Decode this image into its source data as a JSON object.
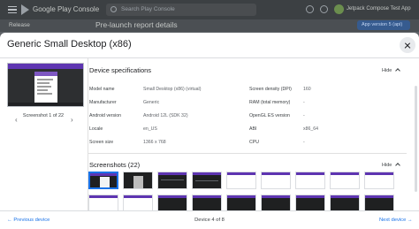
{
  "app": {
    "brand": "Google Play Console",
    "search_placeholder": "Search Play Console",
    "account_name": "Jetpack Compose Test App"
  },
  "subheader": {
    "release_label": "Release",
    "page_title": "Pre-launch report details",
    "version_button": "App version 5 (api)"
  },
  "dialog": {
    "title": "Generic Small Desktop (x86)",
    "screenshot_caption": "Screenshot 1 of 22",
    "specs": {
      "section_title": "Device specifications",
      "hide_label": "Hide",
      "left": [
        {
          "label": "Model name",
          "value": "Small Desktop (x86) (virtual)"
        },
        {
          "label": "Manufacturer",
          "value": "Generic"
        },
        {
          "label": "Android version",
          "value": "Android 12L (SDK 32)"
        },
        {
          "label": "Locale",
          "value": "en_US"
        },
        {
          "label": "Screen size",
          "value": "1366 x 768"
        }
      ],
      "right": [
        {
          "label": "Screen density (DPI)",
          "value": "160"
        },
        {
          "label": "RAM (total memory)",
          "value": "-"
        },
        {
          "label": "OpenGL ES version",
          "value": "-"
        },
        {
          "label": "ABI",
          "value": "x86_64"
        },
        {
          "label": "CPU",
          "value": "-"
        }
      ]
    },
    "screenshots": {
      "section_title": "Screenshots (22)",
      "hide_label": "Hide"
    },
    "footer": {
      "previous": "Previous device",
      "count": "Device 4 of 8",
      "next": "Next device"
    }
  },
  "colors": {
    "accent": "#1a73e8",
    "purple_app_bar": "#5e35b1",
    "overlay_bar": "#3c4043"
  },
  "icons": [
    "menu-icon",
    "play-logo-icon",
    "search-icon",
    "help-icon",
    "notifications-icon",
    "close-icon",
    "chevron-left-icon",
    "chevron-right-icon",
    "chevron-up-icon",
    "arrow-left-icon",
    "arrow-right-icon"
  ]
}
